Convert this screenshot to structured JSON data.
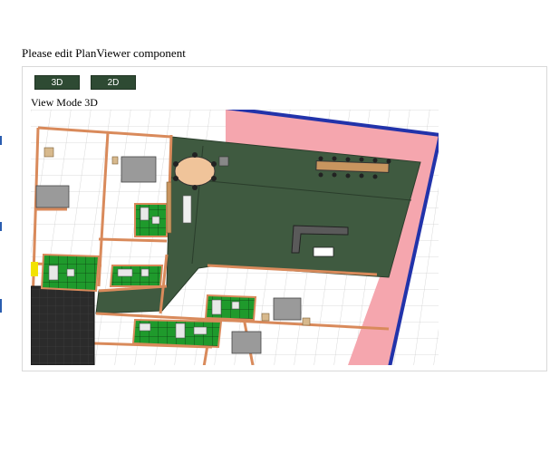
{
  "page": {
    "title": "Please edit PlanViewer component"
  },
  "toolbar": {
    "btn_3d_label": "3D",
    "btn_2d_label": "2D"
  },
  "viewer": {
    "mode_text": "View Mode 3D"
  },
  "colors": {
    "button_bg": "#2e4a33",
    "floor_dark": "#3f5a40",
    "wall": "#d98a5b",
    "boundary_pink": "#f5a6ae",
    "boundary_blue": "#2233aa",
    "bath_green": "#1f9a2c"
  }
}
